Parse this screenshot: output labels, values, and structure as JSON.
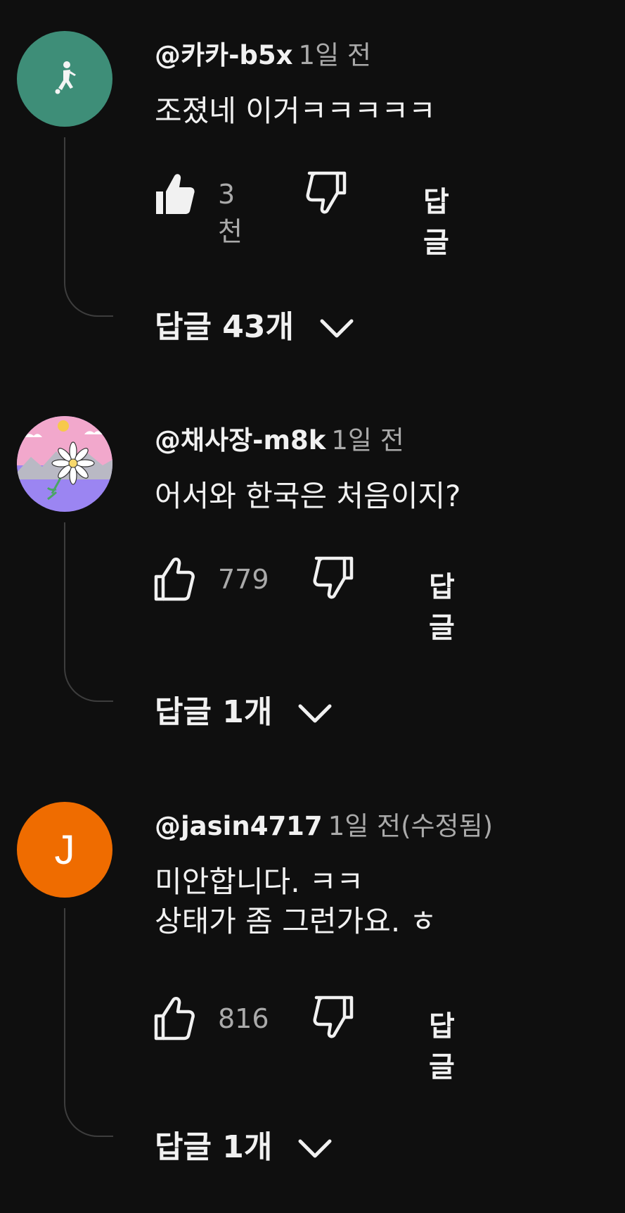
{
  "comments": [
    {
      "author": "@카카-b5x",
      "time": "1일 전",
      "text_lines": [
        "조졌네 이거ㅋㅋㅋㅋㅋ"
      ],
      "likes": "3천",
      "liked": true,
      "reply_label": "답글",
      "replies_label": "답글 43개",
      "avatar": {
        "type": "image",
        "bg": "#3e8e78",
        "icon": "soccer-player-icon"
      }
    },
    {
      "author": "@채사장-m8k",
      "time": "1일 전",
      "text_lines": [
        "어서와 한국은 처음이지?"
      ],
      "likes": "779",
      "liked": false,
      "reply_label": "답글",
      "replies_label": "답글 1개",
      "avatar": {
        "type": "image",
        "bg": "#9b85f2",
        "icon": "edelweiss-flower-icon"
      }
    },
    {
      "author": "@jasin4717",
      "time": "1일 전(수정됨)",
      "text_lines": [
        "미안합니다. ㅋㅋ",
        "상태가 좀 그런가요. ㅎ"
      ],
      "likes": "816",
      "liked": false,
      "reply_label": "답글",
      "replies_label": "답글 1개",
      "avatar": {
        "type": "letter",
        "bg": "#ef6c00",
        "letter": "J"
      }
    }
  ],
  "colors": {
    "background": "#0f0f0f",
    "primary_text": "#f1f1f1",
    "secondary_text": "#aaaaaa",
    "thread_line": "#3d3d3d"
  }
}
